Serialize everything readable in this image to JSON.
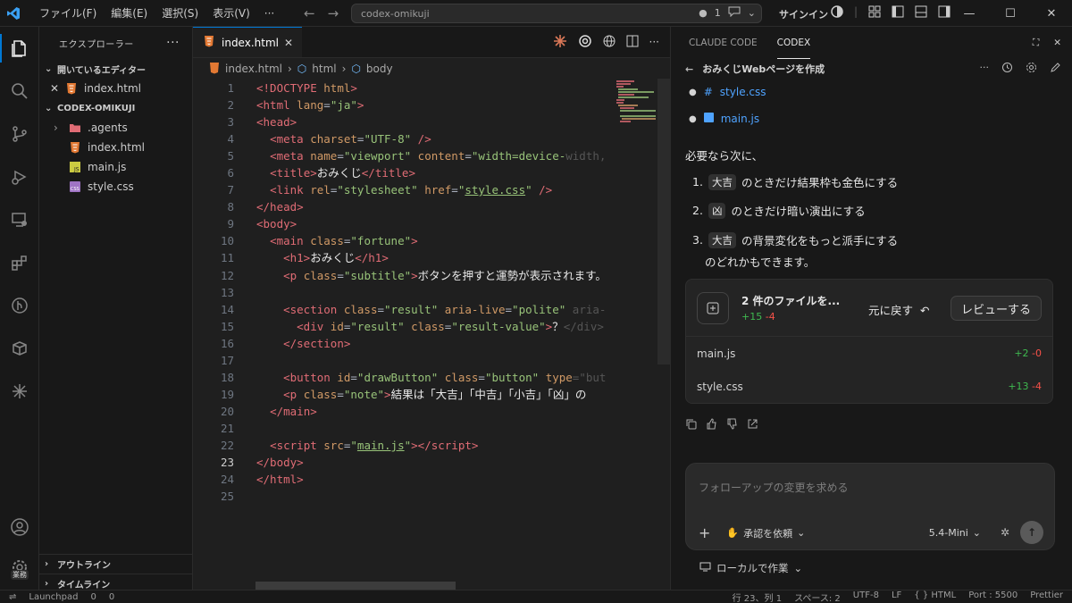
{
  "titlebar": {
    "menu": [
      "ファイル(F)",
      "編集(E)",
      "選択(S)",
      "表示(V)",
      "···"
    ],
    "search_text": "codex-omikuji",
    "search_badge": "1",
    "signin": "サインイン"
  },
  "sidebar": {
    "title": "エクスプローラー",
    "open_editors_label": "開いているエディター",
    "open_editors": [
      {
        "name": "index.html",
        "icon": "html-icon"
      }
    ],
    "folder_label": "CODEX-OMIKUJI",
    "files": [
      {
        "name": ".agents",
        "icon": "folder-icon",
        "color": "#e06c75"
      },
      {
        "name": "index.html",
        "icon": "html-icon",
        "color": "#e37933"
      },
      {
        "name": "main.js",
        "icon": "js-icon",
        "color": "#cbcb41"
      },
      {
        "name": "style.css",
        "icon": "css-icon",
        "color": "#a074c4"
      }
    ],
    "outline_label": "アウトライン",
    "timeline_label": "タイムライン"
  },
  "editor": {
    "tab_label": "index.html",
    "breadcrumb": [
      "index.html",
      "html",
      "body"
    ],
    "current_line": 23,
    "line_numbers": [
      "1",
      "2",
      "3",
      "4",
      "5",
      "6",
      "7",
      "8",
      "9",
      "10",
      "11",
      "12",
      "13",
      "14",
      "15",
      "16",
      "17",
      "18",
      "19",
      "20",
      "21",
      "22",
      "23",
      "24",
      "25"
    ],
    "code": {
      "l11_text": "おみくじ",
      "l12_text": "ボタンを押すと運勢が表示されます。",
      "l15_text": "？",
      "l19_text": "結果は「大吉」「中吉」「小吉」「凶」の"
    }
  },
  "panel": {
    "tabs": [
      "CLAUDE CODE",
      "CODEX"
    ],
    "active_tab": "CODEX",
    "thread_title": "おみくじWebページを作成",
    "files_mentioned": [
      "style.css",
      "main.js"
    ],
    "message_intro": "必要なら次に、",
    "steps": [
      {
        "num": "1.",
        "chip": "大吉",
        "text": "のときだけ結果枠も金色にする"
      },
      {
        "num": "2.",
        "chip": "凶",
        "text": "のときだけ暗い演出にする"
      },
      {
        "num": "3.",
        "chip": "大吉",
        "text": "の背景変化をもっと派手にする"
      }
    ],
    "message_outro": "のどれかもできます。",
    "changes": {
      "title": "2 件のファイルを...",
      "added": "+15",
      "removed": "-4",
      "undo_label": "元に戻す",
      "review_label": "レビューする",
      "files": [
        {
          "name": "main.js",
          "added": "+2",
          "removed": "-0"
        },
        {
          "name": "style.css",
          "added": "+13",
          "removed": "-4"
        }
      ]
    },
    "composer": {
      "placeholder": "フォローアップの変更を求める",
      "approval_label": "承認を依頼",
      "model_label": "5.4-Mini"
    },
    "local_work_label": "ローカルで作業"
  },
  "activitybar": {
    "badge": "業務"
  },
  "statusbar": {
    "left": [
      "Launchpad",
      "0",
      "0"
    ],
    "right": [
      "行 23、列 1",
      "スペース: 2",
      "UTF-8",
      "LF",
      "{ } HTML",
      "Port : 5500",
      "Prettier"
    ]
  }
}
